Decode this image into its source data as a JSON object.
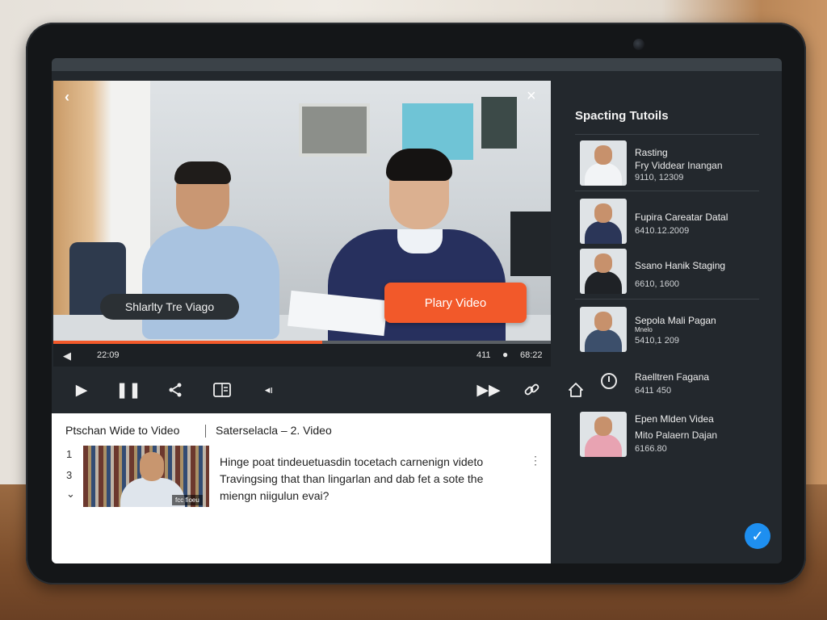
{
  "video": {
    "pill_label": "Shlarlty Tre Viago",
    "play_label": "Plary Video",
    "progress_fraction": 0.54
  },
  "timebar": {
    "current_time": "22:09",
    "count": "411",
    "total_time": "68:22"
  },
  "pane": {
    "title": "Ptschan Wide to Video",
    "subtitle": "Saterselacla – 2. Video",
    "numbers": [
      "1",
      "3"
    ],
    "thumb_caption": "fcc fioeu",
    "text": "Hinge poat tindeuetuasdin tocetach carnenign videto Travingsing that than lingarlan and dab fet a sote the miengn niigulun evai?"
  },
  "sidebar": {
    "title": "Spacting Tutoils",
    "items": [
      {
        "line1": "Rasting",
        "line2": "Fry Viddear Inangan",
        "line3": "9110, 12309"
      },
      {
        "line1": "Fupira Careatar Datal",
        "line2": "",
        "line3": "6410.12.2009"
      },
      {
        "line1": "Ssano Hanik Staging",
        "line2": "",
        "line3": "6610, 1600"
      },
      {
        "line1": "Sepola Mali Pagan",
        "line2": "Mnelo",
        "line3": "5410,1 209"
      },
      {
        "line1": "Raelltren Fagana",
        "line2": "",
        "line3": "6411 450"
      },
      {
        "line1": "Epen Mlden Videa",
        "line2": "Mito Palaern Dajan",
        "line3": "6166.80"
      }
    ]
  },
  "icons": {
    "back": "chevron-left-icon",
    "close": "close-icon",
    "play": "play-icon",
    "pause": "pause-icon",
    "share": "share-icon",
    "captions": "captions-icon",
    "volume": "volume-icon",
    "forward": "fast-forward-icon",
    "link": "link-icon",
    "home": "home-icon",
    "check": "check-icon"
  },
  "colors": {
    "accent": "#f2592a",
    "check": "#1e8ff0",
    "panel": "#23282d"
  }
}
